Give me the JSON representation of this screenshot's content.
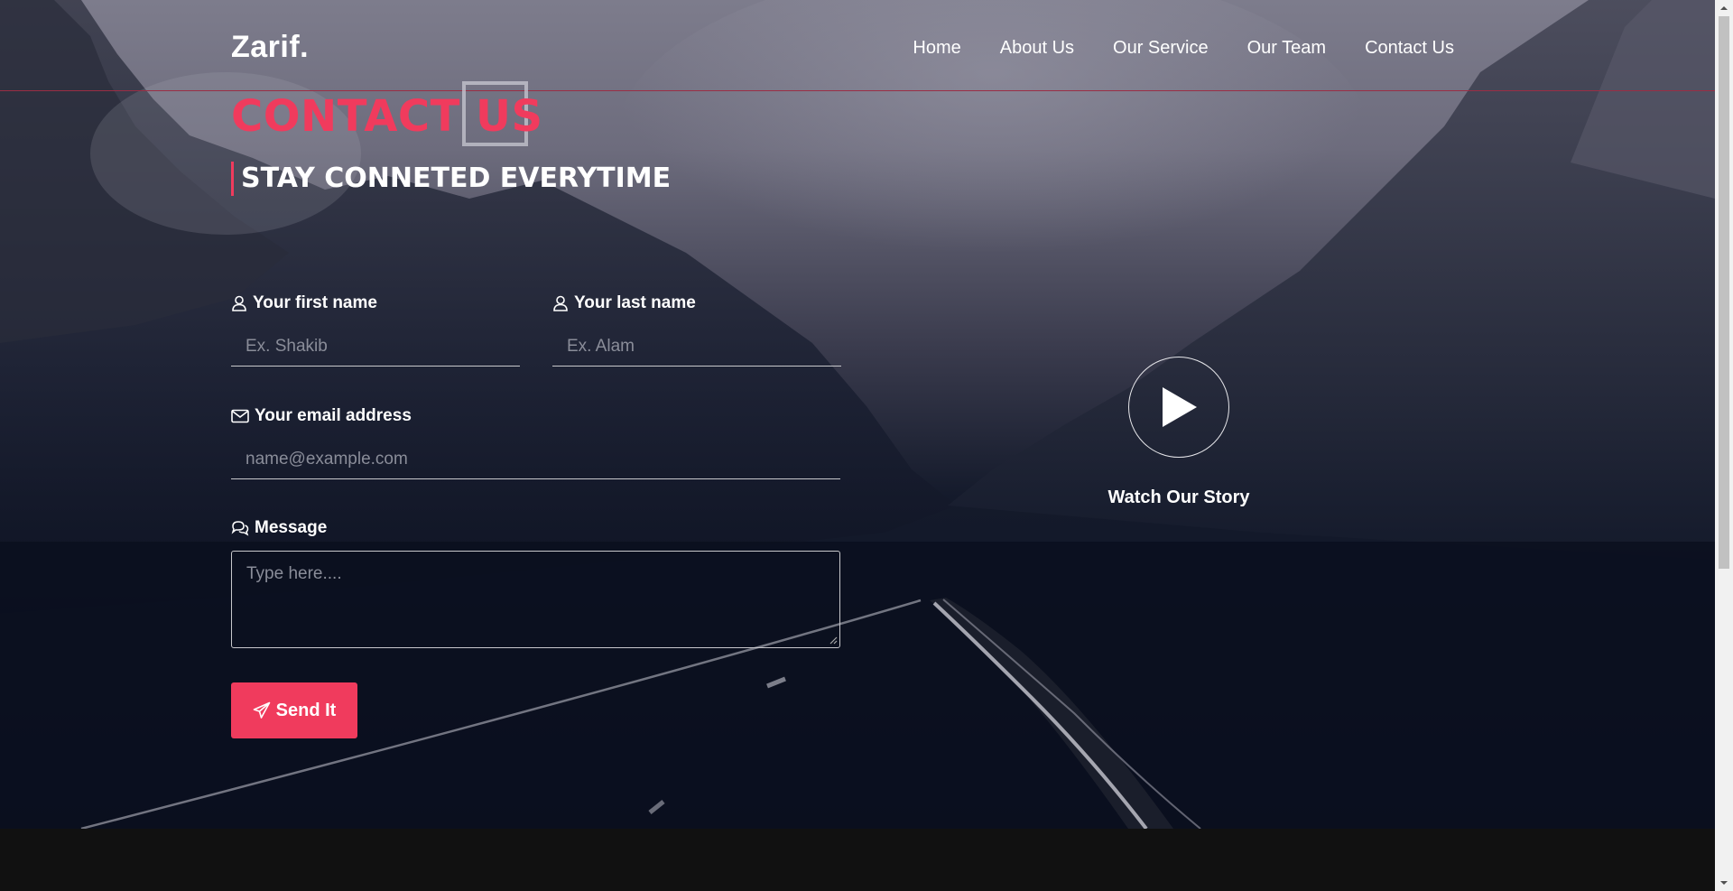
{
  "header": {
    "logo": "Zarif.",
    "nav": [
      "Home",
      "About Us",
      "Our Service",
      "Our Team",
      "Contact Us"
    ]
  },
  "section": {
    "title": "CONTACT US",
    "subtitle": "STAY CONNETED EVERYTIME"
  },
  "form": {
    "first_name": {
      "label": "Your first name",
      "placeholder": "Ex. Shakib",
      "icon": "user-icon"
    },
    "last_name": {
      "label": "Your last name",
      "placeholder": "Ex. Alam",
      "icon": "user-icon"
    },
    "email": {
      "label": "Your email address",
      "placeholder": "name@example.com",
      "icon": "envelope-icon"
    },
    "message": {
      "label": "Message",
      "placeholder": "Type here....",
      "icon": "comments-icon"
    },
    "submit": {
      "label": "Send It",
      "icon": "paper-plane-icon"
    }
  },
  "video": {
    "label": "Watch Our Story",
    "icon": "play-icon"
  },
  "colors": {
    "accent": "#f03b5d",
    "footer": "#111111"
  }
}
